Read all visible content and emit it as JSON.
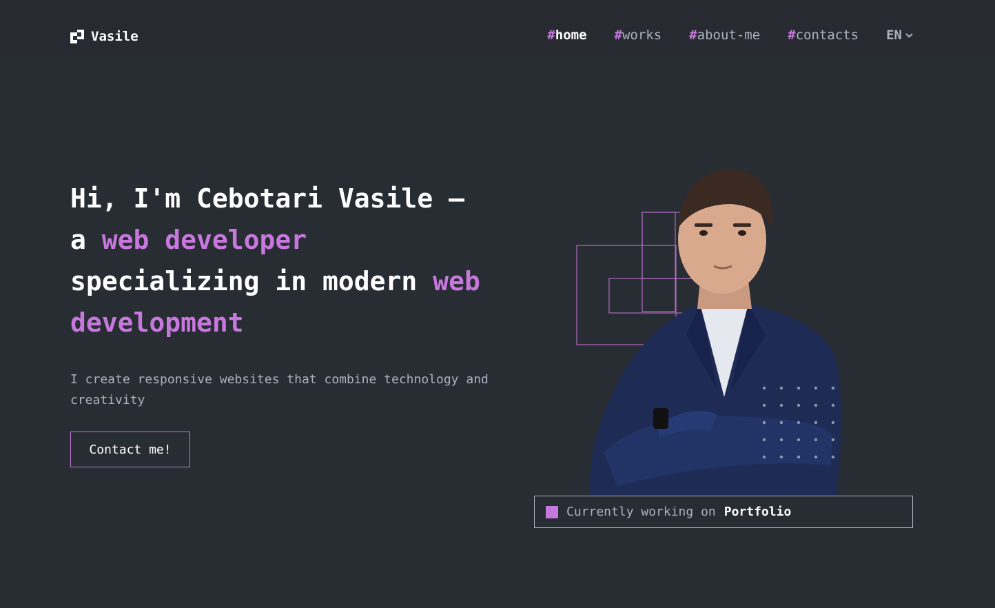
{
  "header": {
    "brand": "Vasile",
    "logo_icon": "logo-icon",
    "nav": [
      {
        "hash": "#",
        "label": "home",
        "active": true
      },
      {
        "hash": "#",
        "label": "works",
        "active": false
      },
      {
        "hash": "#",
        "label": "about-me",
        "active": false
      },
      {
        "hash": "#",
        "label": "contacts",
        "active": false
      }
    ],
    "language": "EN",
    "language_icon": "chevron-down-icon"
  },
  "hero": {
    "title_line1": "Hi, I'm Cebotari Vasile –",
    "title_line2_prefix": "a ",
    "title_line2_accent": "web developer",
    "title_line3_prefix": "specializing in modern ",
    "title_line3_accent": "web",
    "title_line4_accent": "development",
    "subtitle": "I create responsive websites that combine technology and creativity",
    "cta_label": "Contact me!"
  },
  "status": {
    "prefix": "Currently working on",
    "project": "Portfolio"
  },
  "colors": {
    "background": "#282c33",
    "accent": "#c778dd",
    "text_muted": "#abb2bf",
    "text": "#ffffff"
  }
}
